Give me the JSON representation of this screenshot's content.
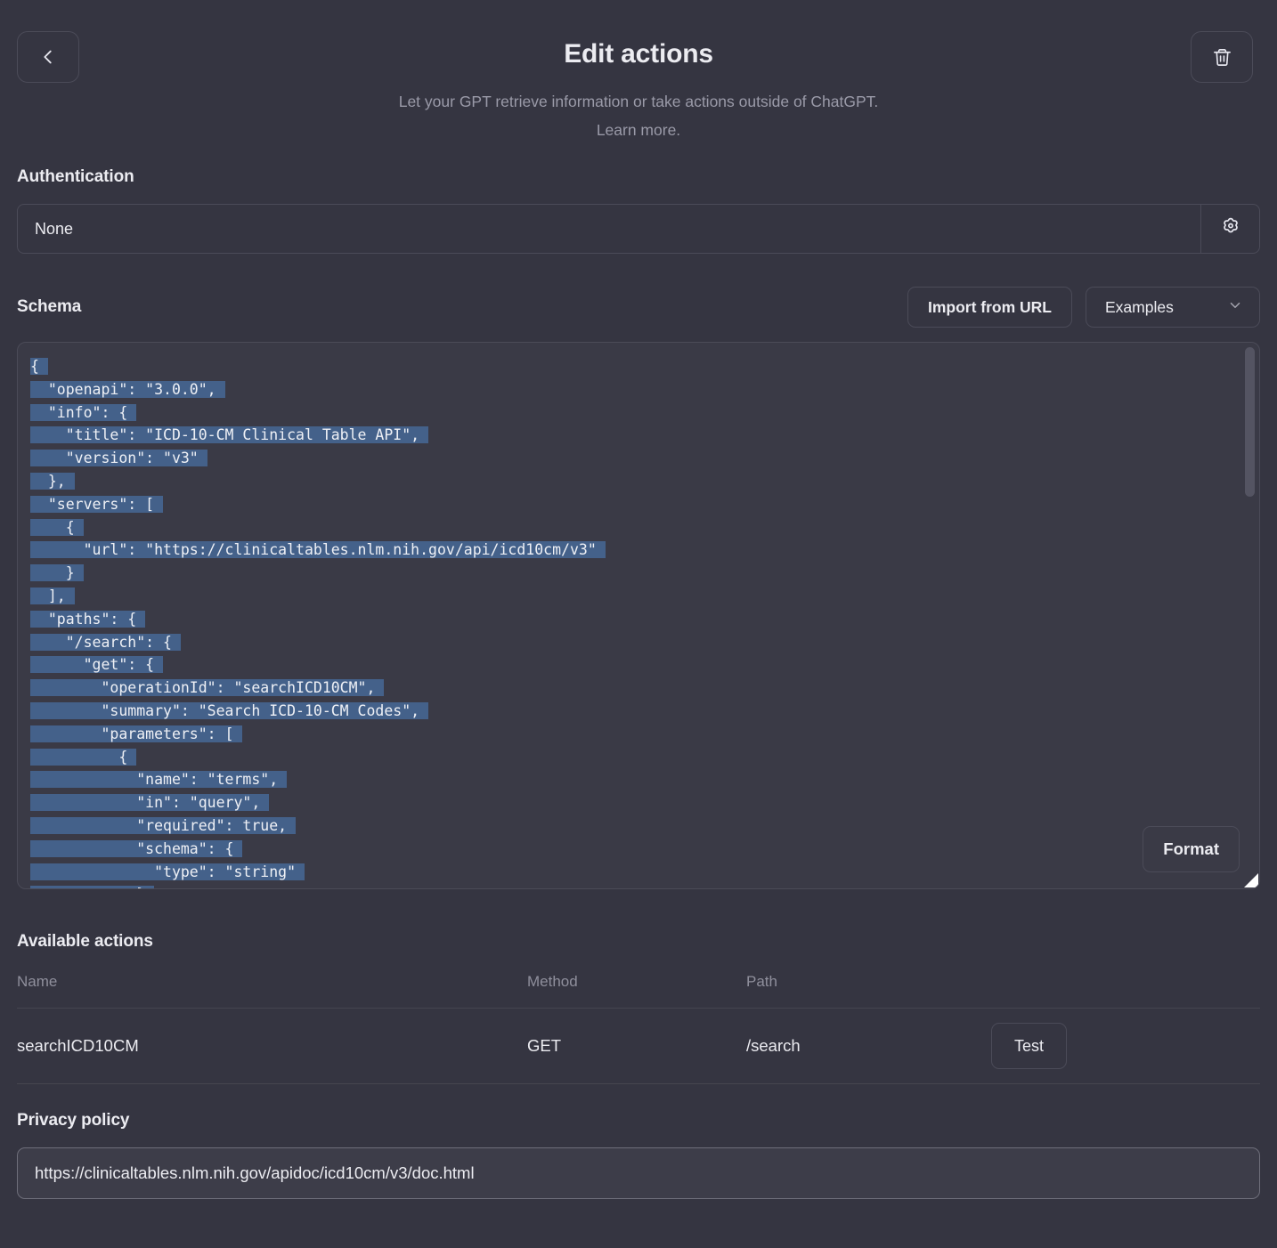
{
  "header": {
    "back_icon": "chevron-left-icon",
    "delete_icon": "trash-icon",
    "title": "Edit actions",
    "subtitle": "Let your GPT retrieve information or take actions outside of ChatGPT.",
    "learn_more": "Learn more."
  },
  "authentication": {
    "label": "Authentication",
    "value": "None",
    "settings_icon": "gear-icon"
  },
  "schema": {
    "label": "Schema",
    "import_button": "Import from URL",
    "examples_select": "Examples",
    "chevron_icon": "chevron-down-icon",
    "format_button": "Format",
    "selection_color": "#44618a",
    "code_lines": [
      "{",
      "  \"openapi\": \"3.0.0\",",
      "  \"info\": {",
      "    \"title\": \"ICD-10-CM Clinical Table API\",",
      "    \"version\": \"v3\"",
      "  },",
      "  \"servers\": [",
      "    {",
      "      \"url\": \"https://clinicaltables.nlm.nih.gov/api/icd10cm/v3\"",
      "    }",
      "  ],",
      "  \"paths\": {",
      "    \"/search\": {",
      "      \"get\": {",
      "        \"operationId\": \"searchICD10CM\",",
      "        \"summary\": \"Search ICD-10-CM Codes\",",
      "        \"parameters\": [",
      "          {",
      "            \"name\": \"terms\",",
      "            \"in\": \"query\",",
      "            \"required\": true,",
      "            \"schema\": {",
      "              \"type\": \"string\"",
      "            }"
    ]
  },
  "available_actions": {
    "label": "Available actions",
    "columns": [
      "Name",
      "Method",
      "Path"
    ],
    "rows": [
      {
        "name": "searchICD10CM",
        "method": "GET",
        "path": "/search",
        "test_label": "Test"
      }
    ]
  },
  "privacy": {
    "label": "Privacy policy",
    "value": "https://clinicaltables.nlm.nih.gov/apidoc/icd10cm/v3/doc.html",
    "placeholder": ""
  }
}
